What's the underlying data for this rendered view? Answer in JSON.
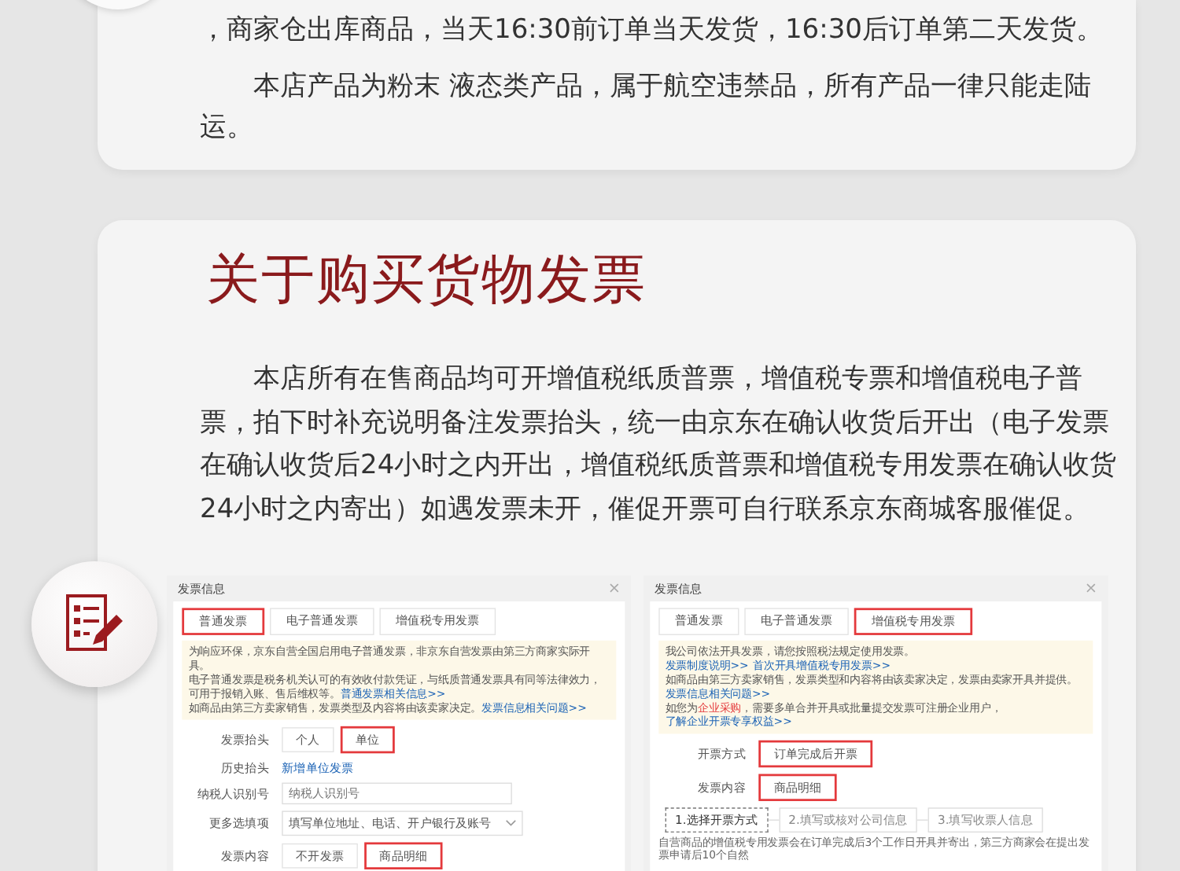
{
  "shipping_notice": {
    "paragraphs": [
      "，商家仓出库商品，当天16:30前订单当天发货，16:30后订单第二天发货。",
      "本店产品为粉末 液态类产品，属于航空违禁品，所有产品一律只能走陆运。"
    ]
  },
  "invoice_section": {
    "title": "关于购买货物发票",
    "paragraph": "本店所有在售商品均可开增值税纸质普票，增值税专票和增值税电子普票，拍下时补充说明备注发票抬头，统一由京东在确认收货后开出（电子发票在确认收货后24小时之内开出，增值税纸质普票和增值税专用发票在确认收货24小时之内寄出）如遇发票未开，催促开票可自行联系京东商城客服催促。",
    "screenshots": [
      {
        "title": "发票信息",
        "close": "×",
        "tabs": [
          {
            "label": "普通发票",
            "selected": true
          },
          {
            "label": "电子普通发票",
            "selected": false
          },
          {
            "label": "增值税专用发票",
            "selected": false
          }
        ],
        "notice": [
          [
            {
              "kind": "text",
              "text": "为响应环保，京东自营全国启用电子普通发票，非京东自营发票由第三方商家实际开具。"
            }
          ],
          [
            {
              "kind": "text",
              "text": "电子普通发票是税务机关认可的有效收付款凭证，与纸质普通发票具有同等法律效力，可用于报销入账、售后维权等。"
            },
            {
              "kind": "link",
              "text": "普通发票相关信息>>"
            }
          ],
          [
            {
              "kind": "text",
              "text": "如商品由第三方卖家销售，发票类型及内容将由该卖家决定。"
            },
            {
              "kind": "link",
              "text": "发票信息相关问题>>"
            }
          ]
        ],
        "rows": [
          {
            "kind": "options",
            "label": "发票抬头",
            "options": [
              {
                "label": "个人",
                "selected": false
              },
              {
                "label": "单位",
                "selected": true
              }
            ]
          },
          {
            "kind": "link",
            "label": "历史抬头",
            "value": "新增单位发票"
          },
          {
            "kind": "input",
            "label": "纳税人识别号",
            "placeholder": "纳税人识别号"
          },
          {
            "kind": "select",
            "label": "更多选填项",
            "value": "填写单位地址、电话、开户银行及账号"
          },
          {
            "kind": "options",
            "label": "发票内容",
            "options": [
              {
                "label": "不开发票",
                "selected": false
              },
              {
                "label": "商品明细",
                "selected": true
              }
            ]
          }
        ]
      },
      {
        "title": "发票信息",
        "close": "×",
        "tabs": [
          {
            "label": "普通发票",
            "selected": false
          },
          {
            "label": "电子普通发票",
            "selected": false
          },
          {
            "label": "增值税专用发票",
            "selected": true
          }
        ],
        "notice": [
          [
            {
              "kind": "text",
              "text": "我公司依法开具发票，请您按照税法规定使用发票。"
            }
          ],
          [
            {
              "kind": "link",
              "text": "发票制度说明>>"
            },
            {
              "kind": "link",
              "text": "首次开具增值税专用发票>>"
            }
          ],
          [
            {
              "kind": "text",
              "text": "如商品由第三方卖家销售，发票类型和内容将由该卖家决定，发票由卖家开具并提供。"
            },
            {
              "kind": "link",
              "text": "发票信息相关问题>>"
            }
          ],
          [
            {
              "kind": "text",
              "text": "如您为"
            },
            {
              "kind": "alert",
              "text": "企业采购"
            },
            {
              "kind": "text",
              "text": "，需要多单合并开具或批量提交发票可注册企业用户，"
            },
            {
              "kind": "link",
              "text": "了解企业开票专享权益>>"
            }
          ]
        ],
        "rows": [
          {
            "kind": "options",
            "label": "开票方式",
            "options": [
              {
                "label": "订单完成后开票",
                "selected": true
              }
            ]
          },
          {
            "kind": "options",
            "label": "发票内容",
            "options": [
              {
                "label": "商品明细",
                "selected": true
              }
            ]
          }
        ],
        "steps": [
          {
            "label": "1.选择开票方式",
            "selected": true
          },
          {
            "label": "2.填写或核对公司信息",
            "selected": false
          },
          {
            "label": "3.填写收票人信息",
            "selected": false
          }
        ],
        "footnote": "自营商品的增值税专用发票会在订单完成后3个工作日开具并寄出，第三方商家会在提出发票申请后10个自然"
      }
    ]
  }
}
